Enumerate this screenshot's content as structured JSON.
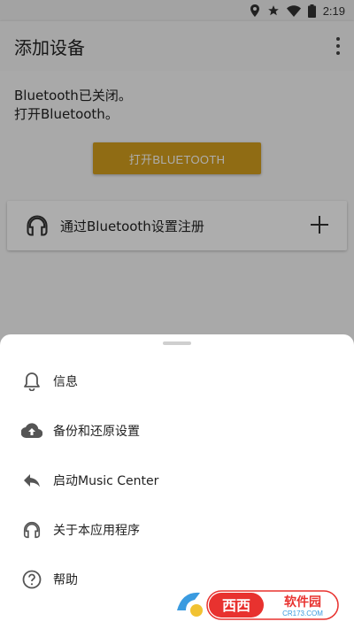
{
  "status_bar": {
    "time": "2:19",
    "icons": [
      "location-icon",
      "star-icon",
      "wifi-icon",
      "battery-icon"
    ]
  },
  "app_bar": {
    "title": "添加设备",
    "more_icon": "more-vert-icon"
  },
  "main": {
    "bluetooth_status_line1": "Bluetooth已关闭。",
    "bluetooth_status_line2": "打开Bluetooth。",
    "turn_on_button": "打开BLUETOOTH",
    "register_card": {
      "icon": "headphones-icon",
      "label": "通过Bluetooth设置注册",
      "action_icon": "plus-icon"
    }
  },
  "bottom_sheet": {
    "items": [
      {
        "icon": "bell-icon",
        "label": "信息"
      },
      {
        "icon": "cloud-upload-icon",
        "label": "备份和还原设置"
      },
      {
        "icon": "reply-icon",
        "label": "启动Music Center"
      },
      {
        "icon": "headphones-icon",
        "label": "关于本应用程序"
      },
      {
        "icon": "help-circle-icon",
        "label": "帮助"
      }
    ]
  },
  "watermark": {
    "brand": "西西软件园",
    "site": "CR173.COM"
  },
  "colors": {
    "accent": "#d4a01e",
    "scrim": "rgba(0,0,0,0.32)",
    "watermark_red": "#e8322f"
  }
}
